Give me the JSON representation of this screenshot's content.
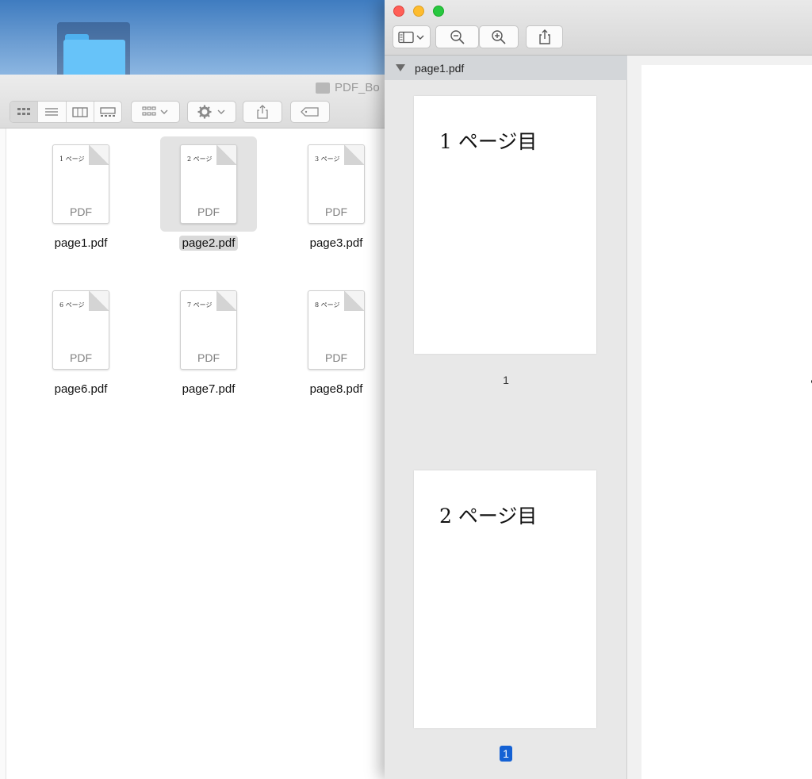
{
  "desktop": {
    "folder_icon": "folder-icon"
  },
  "finder": {
    "title": "PDF_Bo",
    "toolbar": {
      "view_buttons": [
        "icon-view",
        "list-view",
        "column-view",
        "gallery-view"
      ],
      "group_icon": "group-icon",
      "action_icon": "gear-icon",
      "share_icon": "share-icon",
      "tag_icon": "tag-icon"
    },
    "files": [
      {
        "name": "page1.pdf",
        "preview_text": "1 ページ",
        "type_label": "PDF"
      },
      {
        "name": "page2.pdf",
        "preview_text": "2 ページ",
        "type_label": "PDF"
      },
      {
        "name": "page3.pdf",
        "preview_text": "3 ページ",
        "type_label": "PDF"
      },
      {
        "name": "page6.pdf",
        "preview_text": "6 ページ",
        "type_label": "PDF"
      },
      {
        "name": "page7.pdf",
        "preview_text": "7 ページ",
        "type_label": "PDF"
      },
      {
        "name": "page8.pdf",
        "preview_text": "8 ページ",
        "type_label": "PDF"
      }
    ],
    "selected_file": "page2.pdf"
  },
  "preview": {
    "toolbar": {
      "sidebar_icon": "sidebar-icon",
      "zoom_out_icon": "zoom-out-icon",
      "zoom_in_icon": "zoom-in-icon",
      "share_icon": "share-icon"
    },
    "sidebar": {
      "document_name": "page1.pdf",
      "pages": [
        {
          "heading": "1 ページ目",
          "number": "1"
        },
        {
          "heading": "2 ページ目",
          "number": "1"
        }
      ]
    }
  },
  "colors": {
    "accent": "#1461d4",
    "close": "#ff5f57",
    "minimize": "#febc2e",
    "zoom": "#28c840"
  }
}
